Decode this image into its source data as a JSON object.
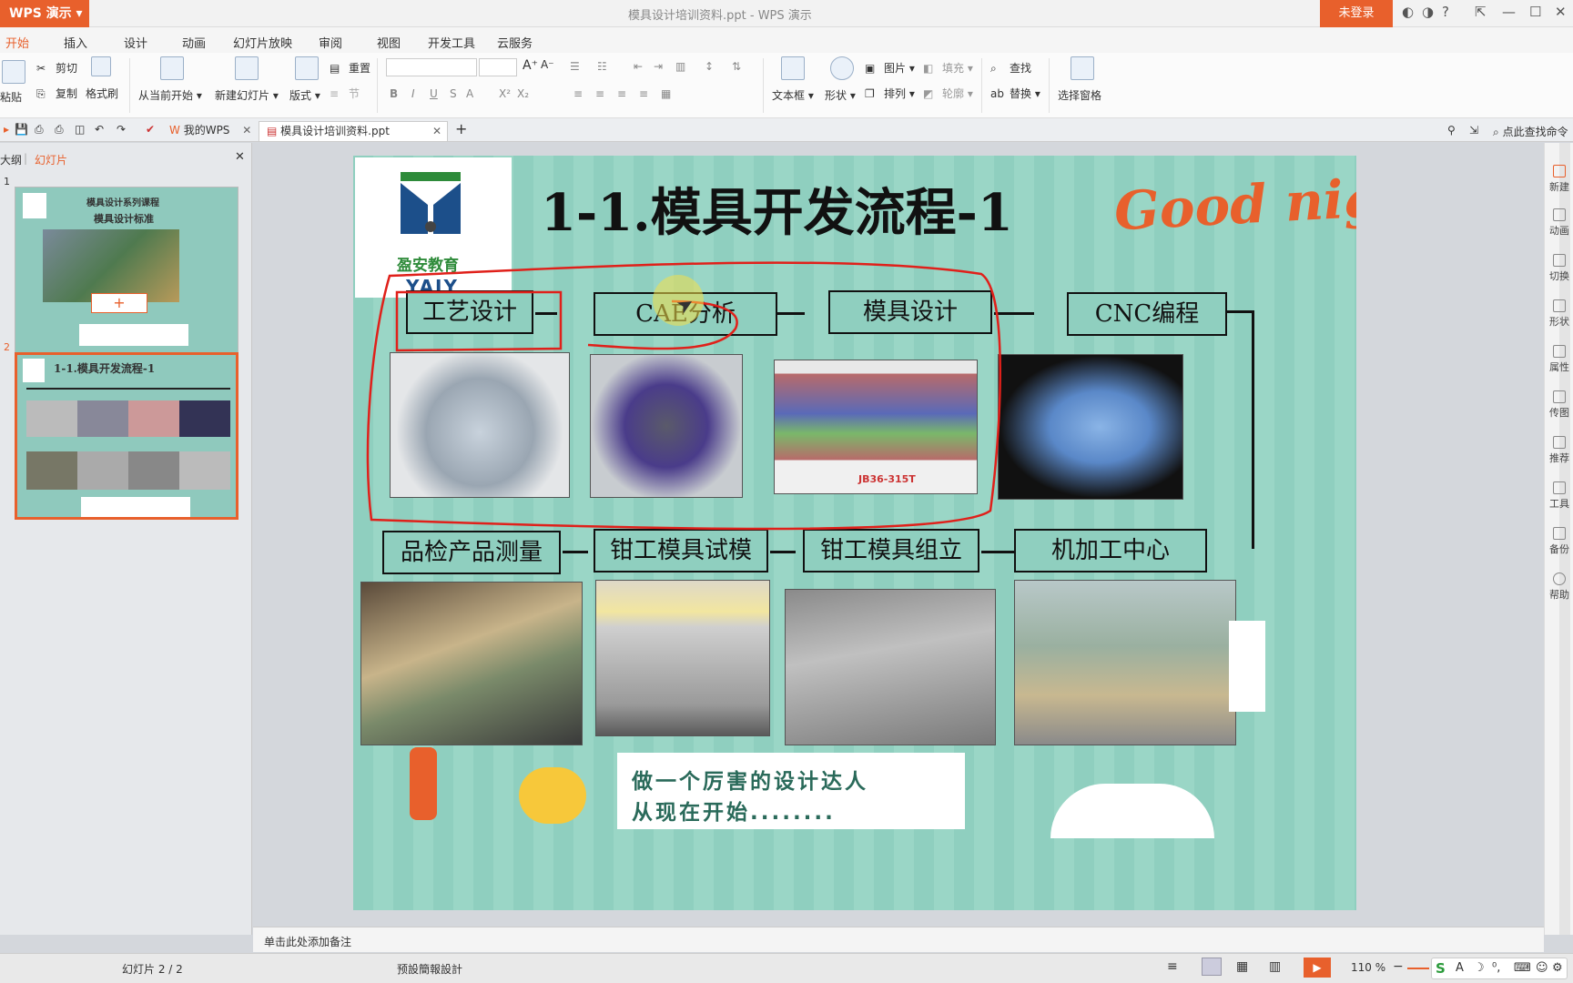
{
  "titlebar": {
    "app_name": "WPS 演示",
    "window_title": "模具设计培训资料.ppt - WPS 演示",
    "login_label": "未登录",
    "help_label": "?"
  },
  "menu_tabs": [
    "开始",
    "插入",
    "设计",
    "动画",
    "幻灯片放映",
    "审阅",
    "视图",
    "开发工具",
    "云服务"
  ],
  "ribbon": {
    "paste": "粘贴",
    "cut": "剪切",
    "copy": "复制",
    "format_painter": "格式刷",
    "from_current": "从当前开始",
    "new_slide": "新建幻灯片",
    "layout": "版式",
    "reset": "重置",
    "section": "节",
    "textbox": "文本框",
    "shape": "形状",
    "picture": "图片",
    "fill": "填充",
    "arrange": "排列",
    "outline": "轮廓",
    "find": "查找",
    "replace": "替换",
    "select_pane": "选择窗格"
  },
  "doc_tabs": {
    "home": "我的WPS",
    "file": "模具设计培训资料.ppt",
    "command_search": "点此查找命令"
  },
  "left_panel": {
    "tab_outline": "大纲",
    "tab_slides": "幻灯片",
    "slide1_num": "1",
    "slide2_num": "2",
    "thumb1_title1": "模具设计系列课程",
    "thumb1_title2": "模具设计标准",
    "thumb2_title": "1-1.模具开发流程-1",
    "add_button": "+"
  },
  "slide": {
    "title": "1-1.模具开发流程-1",
    "logo_cn": "盈安教育",
    "logo_en": "YAJY",
    "goodnight": "Good night",
    "row1": [
      "工艺设计",
      "CAE分析",
      "模具设计",
      "CNC编程"
    ],
    "row2": [
      "品检产品测量",
      "钳工模具试模",
      "钳工模具组立",
      "机加工中心"
    ],
    "press_label": "JB36-315T",
    "slogan1": "做一个厉害的设计达人",
    "slogan2": "从现在开始........"
  },
  "right_bar": [
    "新建",
    "动画",
    "切换",
    "形状",
    "属性",
    "传图",
    "推荐",
    "工具",
    "备份",
    "帮助"
  ],
  "notes": {
    "placeholder": "单击此处添加备注"
  },
  "status": {
    "slide_count": "幻灯片 2 / 2",
    "theme": "预設簡報設計",
    "zoom": "110 %"
  },
  "colors": {
    "accent": "#e8602c",
    "slide_bg": "#8fcfbf",
    "annotation_red": "#e0201a",
    "goodnight_orange": "#e8602c"
  }
}
